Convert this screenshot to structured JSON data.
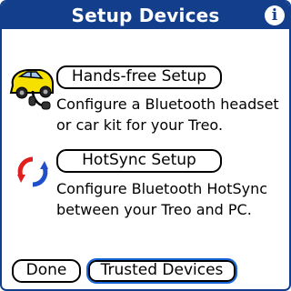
{
  "header": {
    "title": "Setup Devices",
    "info_icon": "info-icon",
    "info_glyph": "i"
  },
  "handsfree": {
    "button_label": "Hands-free Setup",
    "description_line1": "Configure a Bluetooth headset",
    "description_line2": "or car kit for your Treo.",
    "icon": "car-headset-icon"
  },
  "hotsync": {
    "button_label": "HotSync Setup",
    "description_line1": "Configure Bluetooth HotSync",
    "description_line2": "between your Treo and PC.",
    "icon": "hotsync-arrows-icon"
  },
  "footer": {
    "done_label": "Done",
    "trusted_label": "Trusted Devices"
  },
  "colors": {
    "title_bar": "#123e8c",
    "focus_ring": "#1565d8",
    "car_body": "#f5e000",
    "sync_red": "#e02020",
    "sync_blue": "#2050c8"
  }
}
